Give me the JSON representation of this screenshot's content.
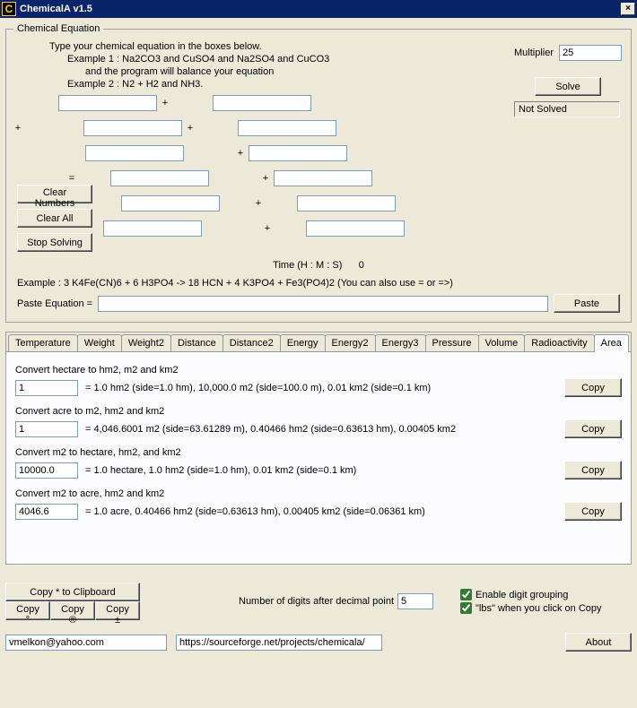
{
  "window": {
    "title": "ChemicalA v1.5",
    "close": "×"
  },
  "equation": {
    "legend": "Chemical Equation",
    "line1": "Type your chemical equation in the boxes below.",
    "line2": "Example 1 : Na2CO3 and CuSO4 and Na2SO4 and CuCO3",
    "line3": "and the program will balance your equation",
    "line4": "Example 2 : N2 + H2 and NH3.",
    "multiplier_label": "Multiplier",
    "multiplier_value": "25",
    "solve": "Solve",
    "status": "Not Solved",
    "clear_numbers": "Clear Numbers",
    "clear_all": "Clear All",
    "stop_solving": "Stop Solving",
    "time_label": "Time (H : M : S)",
    "time_value": "0",
    "plus": "+",
    "eq": "=",
    "example_full": "Example : 3 K4Fe(CN)6 + 6 H3PO4 -> 18 HCN + 4 K3PO4 + Fe3(PO4)2 (You can also use = or =>)",
    "paste_label": "Paste Equation =",
    "paste_btn": "Paste"
  },
  "tabs": [
    "Temperature",
    "Weight",
    "Weight2",
    "Distance",
    "Distance2",
    "Energy",
    "Energy2",
    "Energy3",
    "Pressure",
    "Volume",
    "Radioactivity",
    "Area"
  ],
  "active_tab": "Area",
  "conv": [
    {
      "title": "Convert hectare to hm2, m2 and km2",
      "value": "1",
      "result": "= 1.0 hm2 (side=1.0 hm), 10,000.0 m2 (side=100.0 m), 0.01 km2 (side=0.1 km)"
    },
    {
      "title": "Convert acre to m2, hm2 and km2",
      "value": "1",
      "result": "= 4,046.6001 m2 (side=63.61289 m), 0.40466 hm2 (side=0.63613 hm), 0.00405 km2"
    },
    {
      "title": "Convert m2 to hectare, hm2, and km2",
      "value": "10000.0",
      "result": "= 1.0 hectare, 1.0 hm2 (side=1.0 hm), 0.01 km2 (side=0.1 km)"
    },
    {
      "title": "Convert m2 to acre, hm2 and km2",
      "value": "4046.6",
      "result": "= 1.0 acre, 0.40466 hm2 (side=0.63613 hm), 0.00405 km2 (side=0.06361 km)"
    }
  ],
  "copy_btn": "Copy",
  "copy_clip": "Copy * to Clipboard",
  "copy_deg": "Copy °",
  "copy_reg": "Copy ®",
  "copy_pm": "Copy ±",
  "dec_label": "Number of digits after decimal point",
  "dec_value": "5",
  "cbx1": "Enable digit grouping",
  "cbx2": "\"lbs\" when you click on Copy",
  "footer": {
    "email": "vmelkon@yahoo.com",
    "url": "https://sourceforge.net/projects/chemicala/",
    "about": "About"
  }
}
